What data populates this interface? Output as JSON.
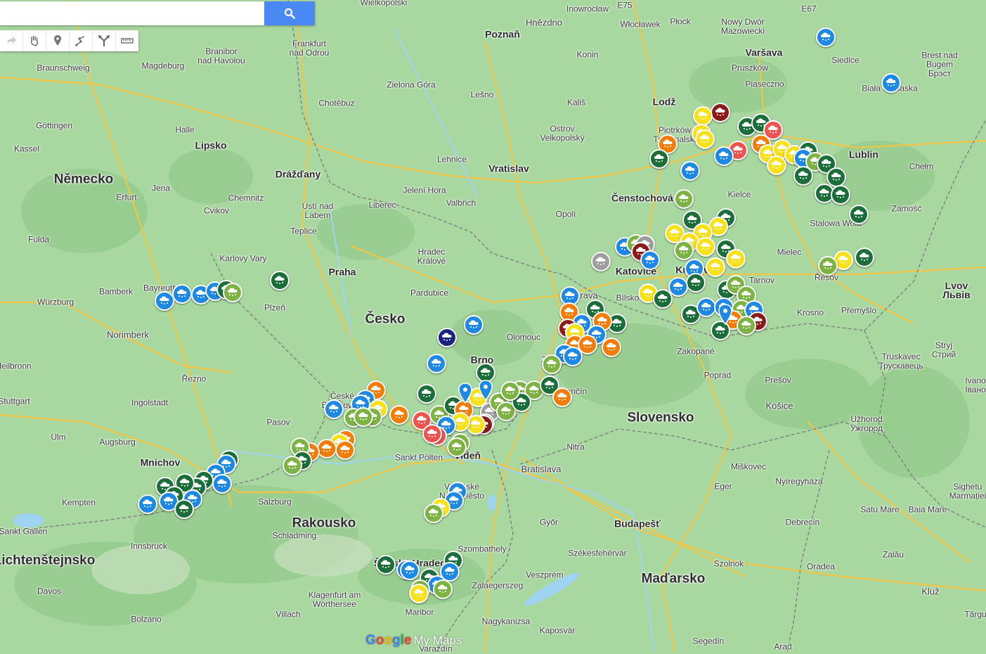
{
  "search": {
    "value": "",
    "placeholder": ""
  },
  "toolbar": {
    "tools": [
      {
        "name": "redo-icon"
      },
      {
        "name": "hand-icon"
      },
      {
        "name": "add-marker-icon"
      },
      {
        "name": "draw-line-icon"
      },
      {
        "name": "directions-icon"
      },
      {
        "name": "ruler-icon"
      }
    ]
  },
  "map": {
    "colors": {
      "land": "#a8d8a0",
      "forest": "#94cc8c",
      "water": "#9fd3f2",
      "highway": "#f5c542",
      "border": "#7b7b7b"
    },
    "labels": [
      {
        "t": "Wielkopolski"
      },
      {
        "t": "Inowrocław"
      },
      {
        "t": "E75"
      },
      {
        "t": "Hnězdno"
      },
      {
        "t": "Włocławek"
      },
      {
        "t": "Płock"
      },
      {
        "t": "Nowy Dwór\nMazowiecki"
      },
      {
        "t": "E67"
      },
      {
        "t": "Poznaň"
      },
      {
        "t": "Frankfurt\nnad Odrou"
      },
      {
        "t": "Branibor\nnad Havolou"
      },
      {
        "t": "Braunschweig"
      },
      {
        "t": "Magdeburg"
      },
      {
        "t": "Konin"
      },
      {
        "t": "Varšava"
      },
      {
        "t": "Brest nad\nBugem\nБрэст"
      },
      {
        "t": "Siedlce"
      },
      {
        "t": "Pruszków"
      },
      {
        "t": "Piaseczno"
      },
      {
        "t": "Biała Podlaska"
      },
      {
        "t": "Zielona Góra"
      },
      {
        "t": "Lešno"
      },
      {
        "t": "Chotěbuz"
      },
      {
        "t": "Kališ"
      },
      {
        "t": "Lodž"
      },
      {
        "t": "Ostrov\nVelkopolský"
      },
      {
        "t": "Piotrków\nTrybunalski"
      },
      {
        "t": "Göttingen"
      },
      {
        "t": "Halle"
      },
      {
        "t": "Lipsko"
      },
      {
        "t": "Kassel"
      },
      {
        "t": "Lublin"
      },
      {
        "t": "Chełm"
      },
      {
        "t": "Lehnice"
      },
      {
        "t": "Vratislav"
      },
      {
        "t": "Drážďany"
      },
      {
        "t": "Německo"
      },
      {
        "t": "Jena"
      },
      {
        "t": "Erfurt"
      },
      {
        "t": "Chemnitz"
      },
      {
        "t": "Jelení Hora"
      },
      {
        "t": "Valbřich"
      },
      {
        "t": "Kielce"
      },
      {
        "t": "Zamość"
      },
      {
        "t": "Čenstochová"
      },
      {
        "t": "Cvikov"
      },
      {
        "t": "Ústí nad\nLabem"
      },
      {
        "t": "Liberec"
      },
      {
        "t": "Opolí"
      },
      {
        "t": "Fulda"
      },
      {
        "t": "Teplice"
      },
      {
        "t": "Stalowa Wola"
      },
      {
        "t": "Hradec\nKrálové"
      },
      {
        "t": "Karlovy Vary"
      },
      {
        "t": "Mielec"
      },
      {
        "t": "Praha"
      },
      {
        "t": "Katovice"
      },
      {
        "t": "Krakov"
      },
      {
        "t": "Tarnov"
      },
      {
        "t": "Řešov"
      },
      {
        "t": "Lvov\nЛьвів"
      },
      {
        "t": "Pardubice"
      },
      {
        "t": "Bamberk"
      },
      {
        "t": "Bayreuth"
      },
      {
        "t": "Ostrava"
      },
      {
        "t": "Bílsko"
      },
      {
        "t": "Würzburg"
      },
      {
        "t": "Plzeň"
      },
      {
        "t": "Krosno"
      },
      {
        "t": "Přemyšlo"
      },
      {
        "t": "Česko"
      },
      {
        "t": "Olomouc"
      },
      {
        "t": "Norimberk"
      },
      {
        "t": "Zakopané"
      },
      {
        "t": "Truskavec\nТрускавець"
      },
      {
        "t": "Stryj\nСтрий"
      },
      {
        "t": "Brno"
      },
      {
        "t": "Zlín"
      },
      {
        "t": "Heilbronn"
      },
      {
        "t": "Řezno"
      },
      {
        "t": "Poprad"
      },
      {
        "t": "Ivano-\nIвано-"
      },
      {
        "t": "Trenčín"
      },
      {
        "t": "Prešov"
      },
      {
        "t": "České\nBudějovice"
      },
      {
        "t": "Ingolstadt"
      },
      {
        "t": "Stuttgart"
      },
      {
        "t": "Slovensko"
      },
      {
        "t": "Košice"
      },
      {
        "t": "Užhorod\nУжгород"
      },
      {
        "t": "Pasov"
      },
      {
        "t": "Ulm"
      },
      {
        "t": "Augsburg"
      },
      {
        "t": "Nitra"
      },
      {
        "t": "Sankt Pölten"
      },
      {
        "t": "Vídeň"
      },
      {
        "t": "Bratislava"
      },
      {
        "t": "Mnichov"
      },
      {
        "t": "Miškovec"
      },
      {
        "t": "Nyíregyháza"
      },
      {
        "t": "Kempten"
      },
      {
        "t": "Salzburg"
      },
      {
        "t": "Eger"
      },
      {
        "t": "Vídeňské\nNové Město"
      },
      {
        "t": "Sighetu\nMarmației"
      },
      {
        "t": "Satu Mare"
      },
      {
        "t": "Baia Mare"
      },
      {
        "t": "Rakousko"
      },
      {
        "t": "Győr"
      },
      {
        "t": "Budapešť"
      },
      {
        "t": "Debrecín"
      },
      {
        "t": "Sankt Gallen"
      },
      {
        "t": "Innsbruck"
      },
      {
        "t": "Schladming"
      },
      {
        "t": "Szombathely"
      },
      {
        "t": "Székesfehérvár"
      },
      {
        "t": "Lichtenštejnsko"
      },
      {
        "t": "Štýrský Hradec"
      },
      {
        "t": "Szolnok"
      },
      {
        "t": "Oradea"
      },
      {
        "t": "Zalău"
      },
      {
        "t": "Maďarsko"
      },
      {
        "t": "Veszprém"
      },
      {
        "t": "Zalaegerszeg"
      },
      {
        "t": "Davos"
      },
      {
        "t": "Klagenfurt am\nWörthersee"
      },
      {
        "t": "Kluž"
      },
      {
        "t": "Villach"
      },
      {
        "t": "Maribor"
      },
      {
        "t": "Nagykanizsa"
      },
      {
        "t": "Kaposvár"
      },
      {
        "t": "Bolzano"
      },
      {
        "t": "Segedín"
      },
      {
        "t": "Arad"
      },
      {
        "t": "Târgu"
      },
      {
        "t": "Varaždín"
      }
    ],
    "markers": {
      "legend_colors": {
        "blue": "#1e88e5",
        "dark_green": "#1b6e3a",
        "light_green": "#7cb342",
        "yellow": "#f9e11a",
        "orange": "#f57c00",
        "red": "#ef5350",
        "dark_red": "#8b1a1a",
        "navy": "#1a237e",
        "gray": "#9e9e9e"
      },
      "icon": "snow-cloud-icon"
    }
  },
  "branding": {
    "google": "Google",
    "product": "My Maps"
  }
}
